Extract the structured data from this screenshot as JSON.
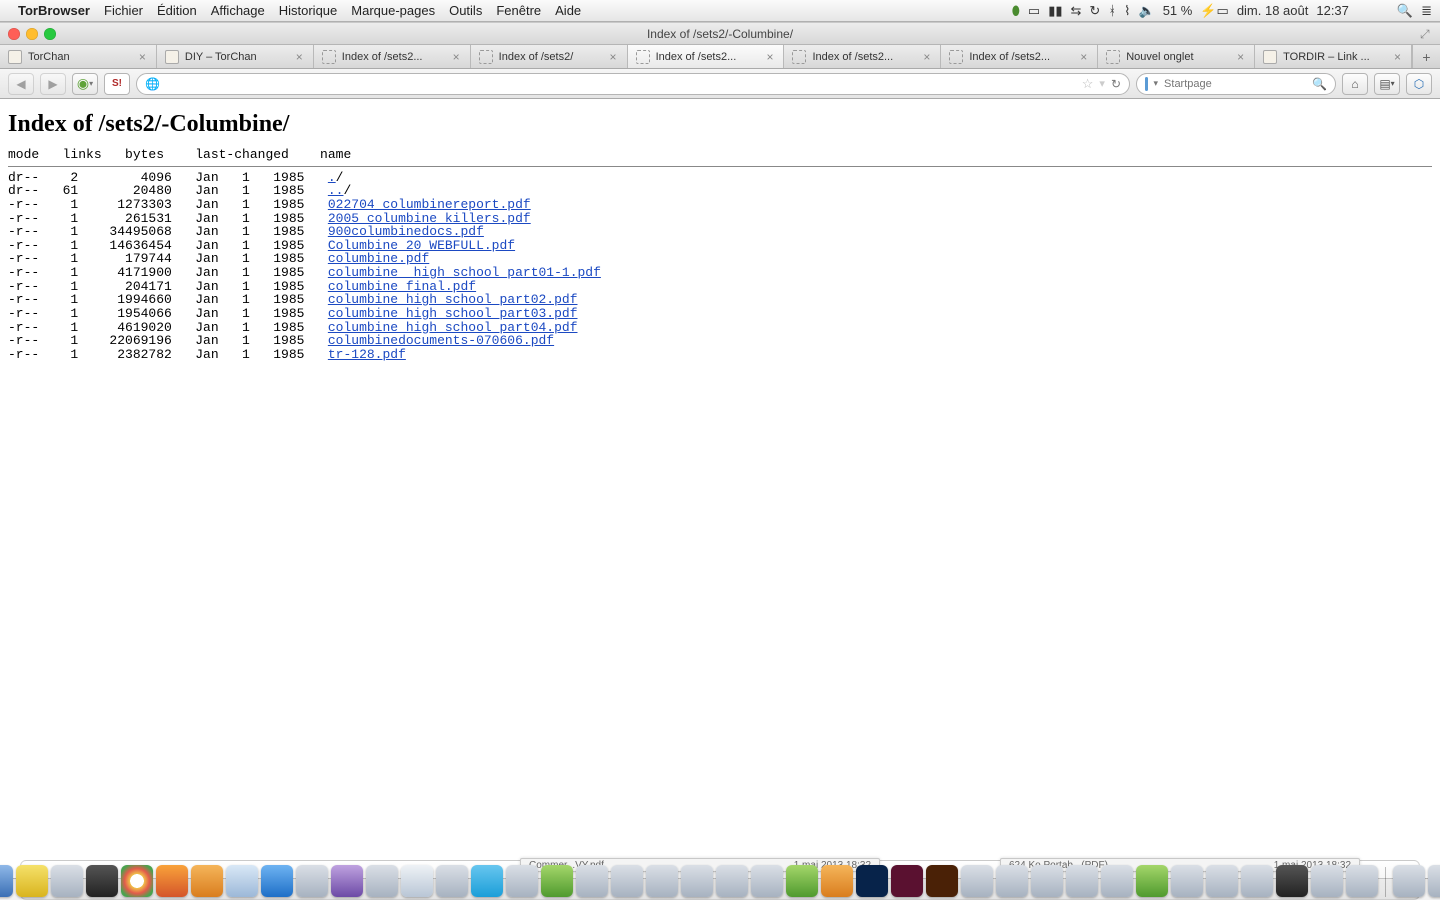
{
  "menubar": {
    "app": "TorBrowser",
    "items": [
      "Fichier",
      "Édition",
      "Affichage",
      "Historique",
      "Marque-pages",
      "Outils",
      "Fenêtre",
      "Aide"
    ],
    "battery": "51 %",
    "date": "dim. 18 août",
    "time": "12:37"
  },
  "window": {
    "title": "Index of /sets2/-Columbine/"
  },
  "tabs": [
    {
      "label": "TorChan",
      "active": false,
      "fav": "tc"
    },
    {
      "label": "DIY – TorChan",
      "active": false,
      "fav": "tc"
    },
    {
      "label": "Index of /sets2...",
      "active": false,
      "fav": "dash"
    },
    {
      "label": "Index of /sets2/",
      "active": false,
      "fav": "dash"
    },
    {
      "label": "Index of /sets2...",
      "active": true,
      "fav": "dash"
    },
    {
      "label": "Index of /sets2...",
      "active": false,
      "fav": "dash"
    },
    {
      "label": "Index of /sets2...",
      "active": false,
      "fav": "dash"
    },
    {
      "label": "Nouvel onglet",
      "active": false,
      "fav": "dash"
    },
    {
      "label": "TORDIR – Link ...",
      "active": false,
      "fav": "tc"
    }
  ],
  "urlbar": {
    "value": ""
  },
  "search": {
    "placeholder": "Startpage"
  },
  "page": {
    "heading": "Index of /sets2/-Columbine/",
    "cols": "mode   links   bytes    last-changed    name",
    "rows": [
      {
        "mode": "dr--",
        "links": "2",
        "bytes": "4096",
        "date": "Jan   1   1985",
        "name": "./",
        "link": true,
        "linktext": "."
      },
      {
        "mode": "dr--",
        "links": "61",
        "bytes": "20480",
        "date": "Jan   1   1985",
        "name": "../",
        "link": true,
        "linktext": ".."
      },
      {
        "mode": "-r--",
        "links": "1",
        "bytes": "1273303",
        "date": "Jan   1   1985",
        "name": "022704_columbinereport.pdf",
        "link": true
      },
      {
        "mode": "-r--",
        "links": "1",
        "bytes": "261531",
        "date": "Jan   1   1985",
        "name": "2005_columbine_killers.pdf",
        "link": true
      },
      {
        "mode": "-r--",
        "links": "1",
        "bytes": "34495068",
        "date": "Jan   1   1985",
        "name": "900columbinedocs.pdf",
        "link": true
      },
      {
        "mode": "-r--",
        "links": "1",
        "bytes": "14636454",
        "date": "Jan   1   1985",
        "name": "Columbine 20 WEBFULL.pdf",
        "link": true
      },
      {
        "mode": "-r--",
        "links": "1",
        "bytes": "179744",
        "date": "Jan   1   1985",
        "name": "columbine.pdf",
        "link": true
      },
      {
        "mode": "-r--",
        "links": "1",
        "bytes": "4171900",
        "date": "Jan   1   1985",
        "name": "columbine _high_school_part01-1.pdf",
        "link": true
      },
      {
        "mode": "-r--",
        "links": "1",
        "bytes": "204171",
        "date": "Jan   1   1985",
        "name": "columbine_final.pdf",
        "link": true
      },
      {
        "mode": "-r--",
        "links": "1",
        "bytes": "1994660",
        "date": "Jan   1   1985",
        "name": "columbine_high_school_part02.pdf",
        "link": true
      },
      {
        "mode": "-r--",
        "links": "1",
        "bytes": "1954066",
        "date": "Jan   1   1985",
        "name": "columbine_high_school_part03.pdf",
        "link": true
      },
      {
        "mode": "-r--",
        "links": "1",
        "bytes": "4619020",
        "date": "Jan   1   1985",
        "name": "columbine_high_school_part04.pdf",
        "link": true
      },
      {
        "mode": "-r--",
        "links": "1",
        "bytes": "22069196",
        "date": "Jan   1   1985",
        "name": "columbinedocuments-070606.pdf",
        "link": true
      },
      {
        "mode": "-r--",
        "links": "1",
        "bytes": "2382782",
        "date": "Jan   1   1985",
        "name": "tr-128.pdf",
        "link": true
      }
    ]
  },
  "mindocs": [
    {
      "name": "Commer...VY.pdf",
      "ts": "1 mai 2013 18:32"
    },
    {
      "name": "624 Ko     Portab...(PDF)",
      "ts": "1 mai 2013 18:32"
    }
  ],
  "dock_count": 42
}
